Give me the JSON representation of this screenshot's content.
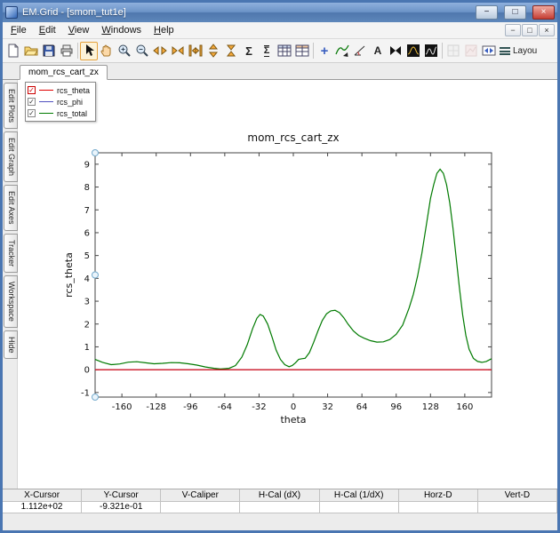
{
  "window": {
    "title": "EM.Grid - [smom_tut1e]",
    "controls": {
      "minimize": "−",
      "maximize": "□",
      "close": "×"
    }
  },
  "menu": {
    "items": [
      "File",
      "Edit",
      "View",
      "Windows",
      "Help"
    ],
    "mdi": {
      "minimize": "−",
      "restore": "□",
      "close": "×"
    }
  },
  "toolbar": {
    "glyphs": {
      "sigma": "Σ",
      "sigma_limits": "Σ",
      "crosshair": "+",
      "text": "A"
    },
    "layout_label": "Layou"
  },
  "tabs": {
    "active": "mom_rcs_cart_zx"
  },
  "sidebar": {
    "tabs": [
      "Edit Plots",
      "Edit Graph",
      "Edit Axes",
      "Tracker",
      "Workspace",
      "Hide"
    ]
  },
  "legend": {
    "check_glyph": "✓"
  },
  "chart_data": {
    "type": "line",
    "title": "mom_rcs_cart_zx",
    "xlabel": "theta",
    "ylabel": "rcs_theta",
    "xlim": [
      -185,
      185
    ],
    "ylim": [
      -1.2,
      9.5
    ],
    "xticks": [
      -160,
      -128,
      -96,
      -64,
      -32,
      0,
      32,
      64,
      96,
      128,
      160
    ],
    "yticks": [
      -1,
      0,
      1,
      2,
      3,
      4,
      5,
      6,
      7,
      8,
      9
    ],
    "series": [
      {
        "name": "rcs_theta",
        "color": "#e00000",
        "x": [
          -185,
          185
        ],
        "y": [
          0,
          0
        ]
      },
      {
        "name": "rcs_phi",
        "color": "#5050c0",
        "x": [
          -185,
          185
        ],
        "y": [
          0,
          0
        ]
      },
      {
        "name": "rcs_total",
        "color": "#007a00",
        "x": [
          -185,
          -178,
          -170,
          -162,
          -154,
          -146,
          -138,
          -130,
          -122,
          -114,
          -106,
          -98,
          -90,
          -82,
          -74,
          -68,
          -60,
          -54,
          -48,
          -43,
          -38,
          -34,
          -31,
          -28,
          -24,
          -20,
          -16,
          -12,
          -8,
          -4,
          -1,
          2,
          5,
          8,
          11,
          15,
          19,
          23,
          27,
          31,
          35,
          39,
          43,
          47,
          51,
          56,
          61,
          66,
          72,
          78,
          84,
          90,
          96,
          102,
          108,
          112,
          116,
          120,
          124,
          128,
          131,
          134,
          137,
          140,
          143,
          146,
          149,
          152,
          155,
          158,
          161,
          164,
          168,
          172,
          176,
          180,
          185
        ],
        "y": [
          0.45,
          0.32,
          0.22,
          0.25,
          0.33,
          0.35,
          0.3,
          0.26,
          0.28,
          0.31,
          0.3,
          0.26,
          0.2,
          0.12,
          0.06,
          0.03,
          0.06,
          0.18,
          0.55,
          1.1,
          1.8,
          2.25,
          2.42,
          2.35,
          2.0,
          1.45,
          0.85,
          0.45,
          0.22,
          0.13,
          0.18,
          0.3,
          0.45,
          0.48,
          0.5,
          0.75,
          1.2,
          1.7,
          2.15,
          2.45,
          2.58,
          2.6,
          2.5,
          2.28,
          2.0,
          1.7,
          1.5,
          1.38,
          1.27,
          1.21,
          1.22,
          1.32,
          1.55,
          1.95,
          2.7,
          3.3,
          4.1,
          5.1,
          6.3,
          7.5,
          8.1,
          8.6,
          8.78,
          8.6,
          8.1,
          7.3,
          6.2,
          4.9,
          3.6,
          2.4,
          1.5,
          0.9,
          0.5,
          0.36,
          0.32,
          0.36,
          0.48
        ]
      }
    ]
  },
  "status_table": {
    "columns": [
      "X-Cursor",
      "Y-Cursor",
      "V-Caliper",
      "H-Cal (dX)",
      "H-Cal (1/dX)",
      "Horz-D",
      "Vert-D"
    ],
    "values": [
      "1.112e+02",
      "-9.321e-01",
      "",
      "",
      "",
      "",
      ""
    ]
  }
}
